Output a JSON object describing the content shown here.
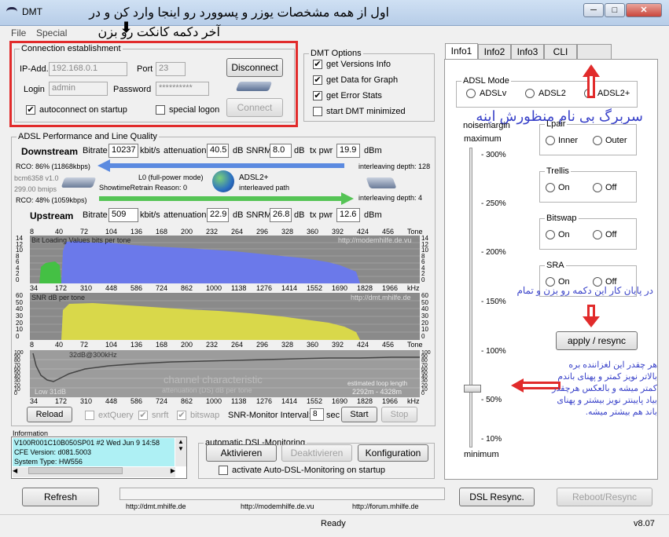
{
  "window": {
    "title": "DMT",
    "min": "─",
    "max": "□",
    "close": "✕"
  },
  "menu": {
    "file": "File",
    "special": "Special"
  },
  "annotations": {
    "top_text": "اول از همه مشخصات یوزر و پسوورد رو اینجا وارد کن و در",
    "top_text2": "آخر دکمه کانکت رو بزن",
    "right_text": "سربرگ بی نام منظورش اینه",
    "apply_text": "در پایان کار این دکمه رو بزن و تمام",
    "noise_text": "هر چقدر این لغزاننده بره بالاتر نویز کمتر و پهنای باندم کمتر میشه و بالعکس هرچقدر بیاد پایینتر نویز بیشتر و پهنای باند هم بیشتر میشه."
  },
  "connection": {
    "legend": "Connection establishment",
    "ip_label": "IP-Add.",
    "ip_value": "192.168.0.1",
    "port_label": "Port",
    "port_value": "23",
    "login_label": "Login",
    "login_value": "admin",
    "password_label": "Password",
    "password_value": "**********",
    "autoconnect_label": "autoconnect on startup",
    "special_logon_label": "special logon",
    "disconnect_label": "Disconnect",
    "connect_label": "Connect"
  },
  "dmt_options": {
    "legend": "DMT Options",
    "opt1": "get Versions Info",
    "opt2": "get Data for Graph",
    "opt3": "get Error Stats",
    "opt4": "start DMT minimized"
  },
  "adsl": {
    "legend": "ADSL Performance and Line Quality",
    "down_label": "Downstream",
    "up_label": "Upstream",
    "bitrate_label": "Bitrate",
    "kbits": "kbit/s",
    "attenuation_label": "attenuation",
    "db": "dB",
    "snrm_label": "SNRM",
    "txpwr_label": "tx pwr",
    "dbm": "dBm",
    "down_bitrate": "10237",
    "down_atten": "40.5",
    "down_snrm": "8.0",
    "down_txpwr": "19.9",
    "up_bitrate": "509",
    "up_atten": "22.9",
    "up_snrm": "26.8",
    "up_txpwr": "12.6",
    "rco_down": "RCO: 86% (11868kbps)",
    "rco_up": "RCO: 48% (1059kbps)",
    "modem_info1": "bcm6358 v1.0",
    "modem_info2": "299.00 bmips",
    "mode": "L0 (full-power mode)",
    "retrain": "ShowtimeRetrain Reason: 0",
    "adsl_type": "ADSL2+",
    "path": "interleaved path",
    "interleave_down": "interleaving depth: 128",
    "interleave_up": "interleaving depth: 4"
  },
  "charts": {
    "top_ticks": [
      "8",
      "40",
      "72",
      "104",
      "136",
      "168",
      "200",
      "232",
      "264",
      "296",
      "328",
      "360",
      "392",
      "424",
      "456",
      "Tone"
    ],
    "khz_ticks": [
      "34",
      "172",
      "310",
      "448",
      "586",
      "724",
      "862",
      "1000",
      "1138",
      "1276",
      "1414",
      "1552",
      "1690",
      "1828",
      "1966",
      "kHz"
    ],
    "bit_title": "Bit Loading Values   bits per tone",
    "bit_site": "http://modemhilfe.de.vu",
    "bit_y": [
      "14",
      "12",
      "10",
      "8",
      "6",
      "4",
      "2",
      "0"
    ],
    "snr_title": "SNR  dB per tone",
    "snr_site": "http://dmt.mhilfe.de",
    "snr_y": [
      "60",
      "50",
      "40",
      "30",
      "20",
      "10",
      "0"
    ],
    "chan_y_left": [
      "100",
      "90",
      "80",
      "70",
      "60",
      "50",
      "40",
      "30",
      "20",
      "10",
      "0"
    ],
    "chan_y_right": [
      "100",
      "90",
      "80",
      "70",
      "60",
      "50",
      "40",
      "30",
      "20",
      "10",
      "0"
    ],
    "chan_title": "channel characteristic",
    "chan_sub": "attenuation (DS)  dB per tone",
    "chan_label_top": "32dB@300kHz",
    "chan_label_bottom": "Low 31dB",
    "chan_loop": "estimated loop length",
    "chan_loop_val": "2292m - 4328m",
    "colors": {
      "bits_up": "#44c044",
      "bits_down": "#6b79ea",
      "snr": "#d9d84a",
      "bg": "#8a8a8a"
    }
  },
  "controls": {
    "reload": "Reload",
    "extquery": "extQuery",
    "snrft": "snrft",
    "bitswap": "bitswap",
    "interval_label": "SNR-Monitor Interval:",
    "interval_value": "8",
    "sec": "sec",
    "start": "Start",
    "stop": "Stop"
  },
  "information": {
    "legend": "Information",
    "line1": "V100R001C10B050SP01    #2 Wed Jun 9 14:58",
    "line2": "CFE Version: d081.5003",
    "line3": "System Type: HW556"
  },
  "monitoring": {
    "legend": "automatic DSL-Monitoring",
    "aktivieren": "Aktivieren",
    "deaktivieren": "Deaktivieren",
    "konfiguration": "Konfiguration",
    "activate_label": "activate Auto-DSL-Monitoring on startup"
  },
  "bottom": {
    "refresh": "Refresh",
    "dsl_resync": "DSL Resync.",
    "reboot": "Reboot/Resync",
    "link1": "http://dmt.mhilfe.de",
    "link2": "http://modemhilfe.de.vu",
    "link3": "http://forum.mhilfe.de",
    "status": "Ready",
    "version": "v8.07"
  },
  "tabs": {
    "t1": "Info1",
    "t2": "Info2",
    "t3": "Info3",
    "t4": "CLI",
    "t5": ""
  },
  "adsl_mode": {
    "legend": "ADSL Mode",
    "o1": "ADSLv",
    "o2": "ADSL2",
    "o3": "ADSL2+"
  },
  "noisemargin": {
    "title": "noisemargin",
    "max": "maximum",
    "min": "minimum",
    "marks": [
      "300%",
      "250%",
      "200%",
      "150%",
      "100%",
      "50%",
      "10%"
    ],
    "slider_level_percent": 50
  },
  "lpair": {
    "legend": "Lpair",
    "o1": "Inner",
    "o2": "Outer"
  },
  "trellis": {
    "legend": "Trellis",
    "o1": "On",
    "o2": "Off"
  },
  "bitswap_opt": {
    "legend": "Bitswap",
    "o1": "On",
    "o2": "Off"
  },
  "sra": {
    "legend": "SRA",
    "o1": "On",
    "o2": "Off"
  },
  "apply_label": "apply / resync"
}
